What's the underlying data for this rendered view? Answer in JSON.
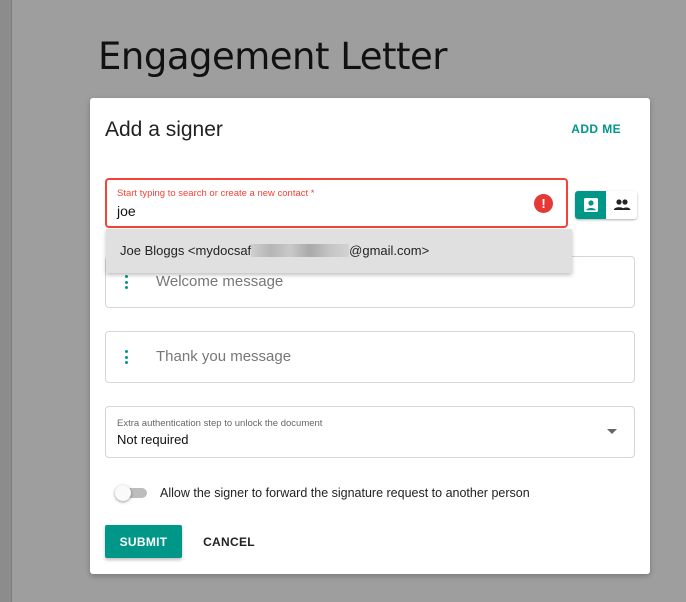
{
  "document": {
    "title": "Engagement Letter"
  },
  "dialog": {
    "title": "Add a signer",
    "add_me_label": "ADD ME",
    "contact": {
      "label": "Start typing to search or create a new contact *",
      "value": "joe",
      "error_icon": "exclamation-icon",
      "error_color": "#f44336",
      "toggle": {
        "active": "single-person-icon",
        "inactive": "group-people-icon"
      }
    },
    "autocomplete": {
      "suggestion_prefix": "Joe Bloggs <mydocsaf",
      "suggestion_suffix": "@gmail.com>"
    },
    "welcome_message": {
      "placeholder": "Welcome message",
      "icon": "more-vert-icon"
    },
    "thank_you_message": {
      "placeholder": "Thank you message",
      "icon": "more-vert-icon"
    },
    "authentication": {
      "label": "Extra authentication step to unlock the document",
      "value": "Not required",
      "icon": "dropdown-arrow-icon"
    },
    "forward": {
      "label": "Allow the signer to forward the signature request to another person",
      "enabled": false
    },
    "submit_label": "SUBMIT",
    "cancel_label": "CANCEL"
  },
  "colors": {
    "accent": "#009688",
    "error": "#f44336",
    "backdrop": "#9e9e9e"
  }
}
